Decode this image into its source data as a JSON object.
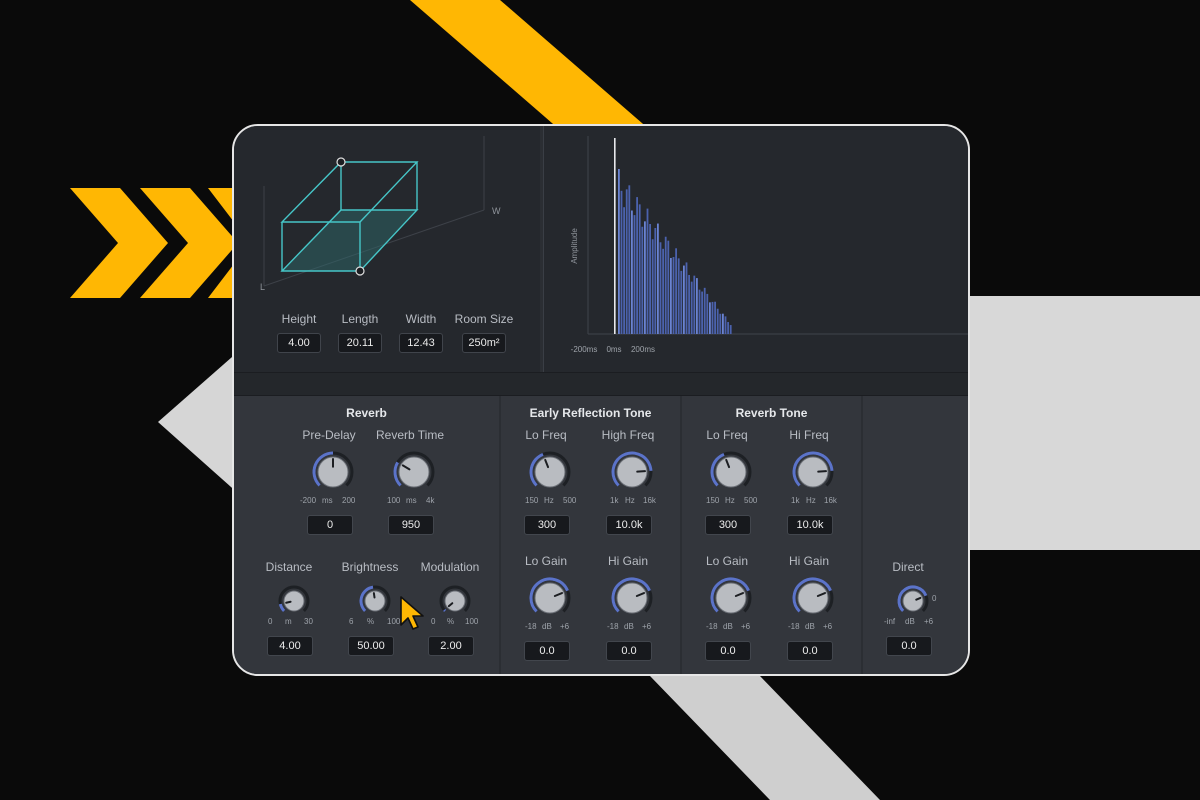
{
  "accent_color": "#ffb703",
  "knob_ring_color": "#5b73c9",
  "room": {
    "axis_labels": {
      "w": "W",
      "l": "L"
    },
    "dimensions": [
      {
        "label": "Height",
        "value": "4.00"
      },
      {
        "label": "Length",
        "value": "20.11"
      },
      {
        "label": "Width",
        "value": "12.43"
      },
      {
        "label": "Room Size",
        "value": "250m²"
      }
    ]
  },
  "graph": {
    "y_label": "Amplitude",
    "x_ticks": [
      "-200ms",
      "0ms",
      "200ms"
    ]
  },
  "reverb": {
    "title": "Reverb",
    "pre_delay": {
      "label": "Pre-Delay",
      "min": "-200",
      "unit": "ms",
      "max": "200",
      "value": "0"
    },
    "reverb_time": {
      "label": "Reverb Time",
      "min": "100",
      "unit": "ms",
      "max": "4k",
      "value": "950"
    },
    "distance": {
      "label": "Distance",
      "min": "0",
      "unit": "m",
      "max": "30",
      "value": "4.00"
    },
    "brightness": {
      "label": "Brightness",
      "min": "6",
      "unit": "%",
      "max": "100",
      "value": "50.00"
    },
    "modulation": {
      "label": "Modulation",
      "min": "0",
      "unit": "%",
      "max": "100",
      "value": "2.00"
    }
  },
  "early_reflection_tone": {
    "title": "Early Reflection Tone",
    "lo_freq": {
      "label": "Lo Freq",
      "min": "150",
      "unit": "Hz",
      "max": "500",
      "value": "300"
    },
    "high_freq": {
      "label": "High Freq",
      "min": "1k",
      "unit": "Hz",
      "max": "16k",
      "value": "10.0k"
    },
    "lo_gain": {
      "label": "Lo Gain",
      "min": "-18",
      "unit": "dB",
      "max": "+6",
      "value": "0.0"
    },
    "hi_gain": {
      "label": "Hi Gain",
      "min": "-18",
      "unit": "dB",
      "max": "+6",
      "value": "0.0"
    }
  },
  "reverb_tone": {
    "title": "Reverb Tone",
    "lo_freq": {
      "label": "Lo Freq",
      "min": "150",
      "unit": "Hz",
      "max": "500",
      "value": "300"
    },
    "hi_freq": {
      "label": "Hi Freq",
      "min": "1k",
      "unit": "Hz",
      "max": "16k",
      "value": "10.0k"
    },
    "lo_gain": {
      "label": "Lo Gain",
      "min": "-18",
      "unit": "dB",
      "max": "+6",
      "value": "0.0"
    },
    "hi_gain": {
      "label": "Hi Gain",
      "min": "-18",
      "unit": "dB",
      "max": "+6",
      "value": "0.0"
    }
  },
  "mix": {
    "direct": {
      "label": "Direct",
      "min": "-inf",
      "unit": "dB",
      "max": "+6",
      "side": "0",
      "value": "0.0"
    }
  }
}
